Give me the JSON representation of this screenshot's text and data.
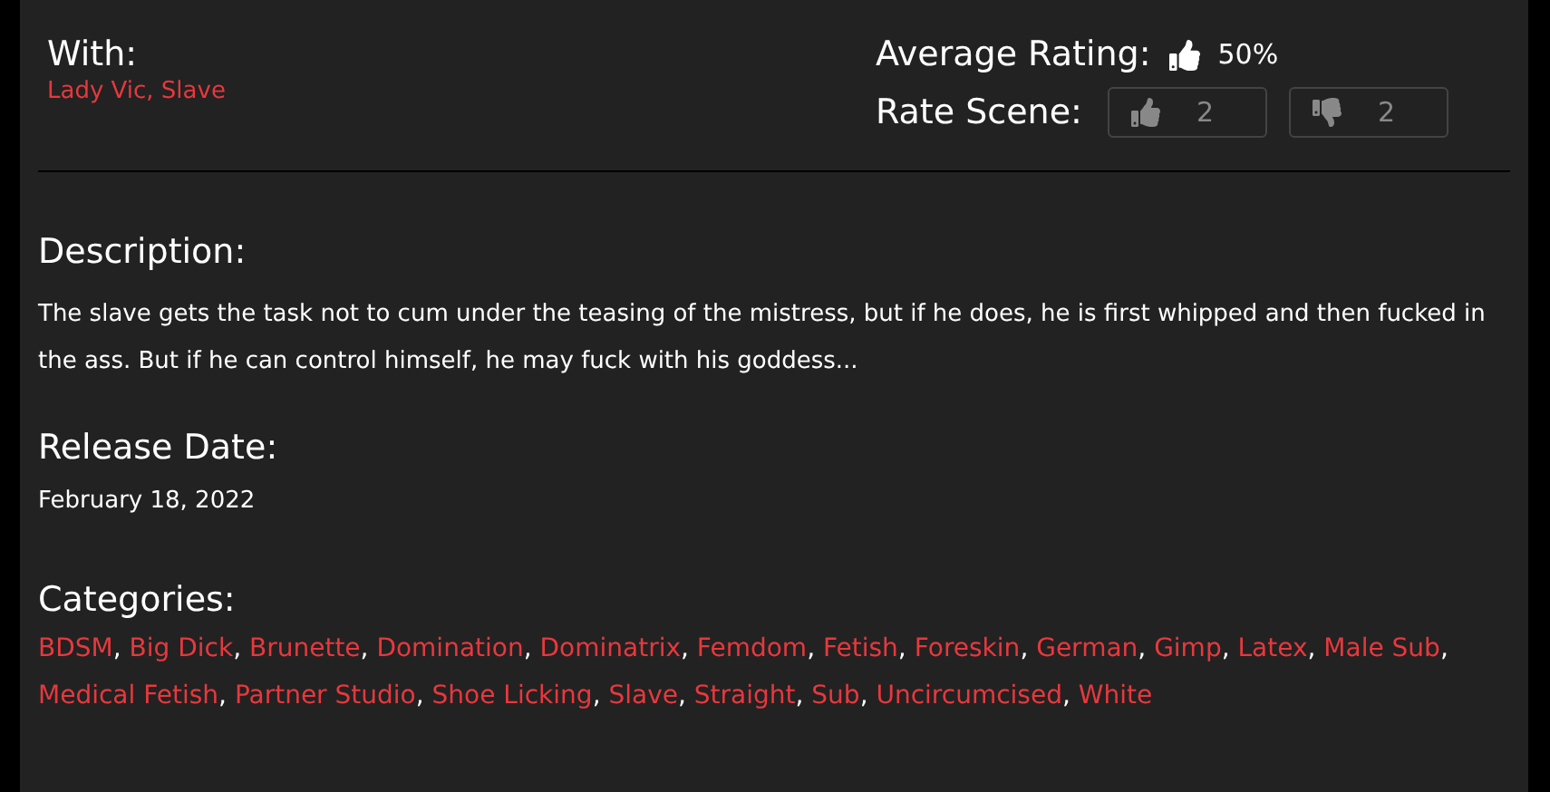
{
  "with": {
    "label": "With:",
    "performers": "Lady Vic, Slave"
  },
  "rating": {
    "label": "Average Rating:",
    "value": "50%",
    "rate_label": "Rate Scene:",
    "likes": "2",
    "dislikes": "2"
  },
  "description": {
    "label": "Description:",
    "text": "The slave gets the task not to cum under the teasing of the mistress, but if he does, he is first whipped and then fucked in the ass. But if he can control himself, he may fuck with his goddess..."
  },
  "release": {
    "label": "Release Date:",
    "date": "February 18, 2022"
  },
  "categories": {
    "label": "Categories:",
    "separator": ",",
    "items": [
      "BDSM",
      "Big Dick",
      "Brunette",
      "Domination",
      "Dominatrix",
      "Femdom",
      "Fetish",
      "Foreskin",
      "German",
      "Gimp",
      "Latex",
      "Male Sub",
      "Medical Fetish",
      "Partner Studio",
      "Shoe Licking",
      "Slave",
      "Straight",
      "Sub",
      "Uncircumcised",
      "White"
    ]
  }
}
